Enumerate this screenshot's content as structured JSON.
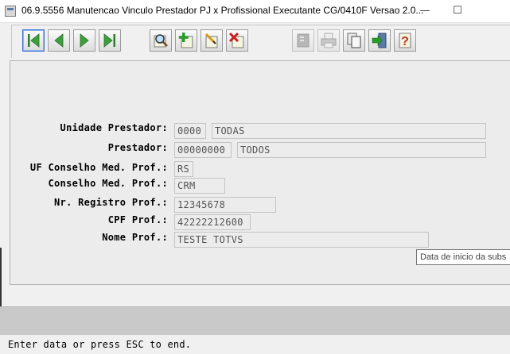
{
  "window": {
    "title": "06.9.5556 Manutencao Vinculo Prestador PJ x Profissional Executante CG/0410F Versao 2.0...",
    "minimize": "—",
    "maximize": "☐"
  },
  "toolbar": {
    "buttons": [
      {
        "name": "first-record-button",
        "icon": "first-record-icon"
      },
      {
        "name": "previous-record-button",
        "icon": "previous-icon"
      },
      {
        "name": "next-record-button",
        "icon": "next-icon"
      },
      {
        "name": "last-record-button",
        "icon": "last-record-icon"
      },
      {
        "name": "search-button",
        "icon": "magnifier-icon"
      },
      {
        "name": "add-button",
        "icon": "plus-icon"
      },
      {
        "name": "edit-button",
        "icon": "pencil-icon"
      },
      {
        "name": "delete-button",
        "icon": "delete-x-icon"
      },
      {
        "name": "filter-button",
        "icon": "filter-icon"
      },
      {
        "name": "print-button",
        "icon": "printer-icon"
      },
      {
        "name": "copy-button",
        "icon": "copy-pages-icon"
      },
      {
        "name": "exit-button",
        "icon": "exit-door-icon"
      },
      {
        "name": "help-button",
        "icon": "help-question-icon"
      }
    ],
    "colors": {
      "accent_blue": "#3a6fd0",
      "plus_green": "#2a9a2a",
      "delete_red": "#c82020",
      "help_red": "#c03020"
    }
  },
  "form": {
    "unidade_prestador": {
      "label": "Unidade Prestador:",
      "code": "0000",
      "desc": "TODAS"
    },
    "prestador": {
      "label": "Prestador:",
      "code": "00000000",
      "desc": "TODOS"
    },
    "uf_conselho": {
      "label": "UF Conselho Med. Prof.:",
      "value": "RS"
    },
    "conselho": {
      "label": "Conselho Med. Prof.:",
      "value": "CRM"
    },
    "nr_registro": {
      "label": "Nr. Registro Prof.:",
      "value": "12345678"
    },
    "cpf": {
      "label": "CPF Prof.:",
      "value": "42222212600"
    },
    "nome": {
      "label": "Nome Prof.:",
      "value": "TESTE TOTVS"
    }
  },
  "tooltip": {
    "text": "Data de inicio da subs"
  },
  "status": {
    "text": "Enter data or press ESC to end."
  }
}
